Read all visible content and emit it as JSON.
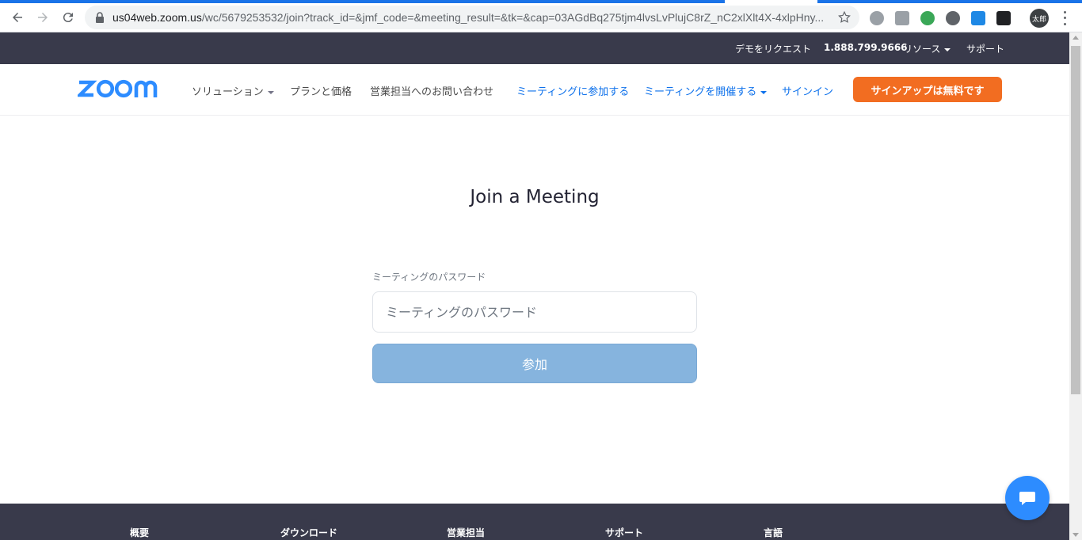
{
  "browser": {
    "url_host": "us04web.zoom.us",
    "url_path": "/wc/5679253532/join?track_id=&jmf_code=&meeting_result=&tk=&cap=03AGdBq275tjm4lvsLvPlujC8rZ_nC2xlXlt4X-4xlpHny...",
    "avatar_text": "太郎"
  },
  "topbar": {
    "demo": "デモをリクエスト",
    "phone": "1.888.799.9666",
    "resources": "リソース",
    "support": "サポート"
  },
  "nav": {
    "solutions": "ソリューション",
    "plans": "プランと価格",
    "sales": "営業担当へのお問い合わせ",
    "join": "ミーティングに参加する",
    "host": "ミーティングを開催する",
    "signin": "サインイン",
    "signup": "サインアップは無料です"
  },
  "main": {
    "title": "Join a Meeting",
    "password_label": "ミーティングのパスワード",
    "password_placeholder": "ミーティングのパスワード",
    "password_value": "",
    "join_button": "参加"
  },
  "footer": {
    "col1": "概要",
    "col2": "ダウンロード",
    "col3": "営業担当",
    "col4": "サポート",
    "col5": "言語"
  },
  "colors": {
    "brand_blue": "#2d8cff",
    "header_dark": "#393a4b",
    "signup_orange": "#f26d21",
    "join_button": "#86b4de"
  },
  "icons": [
    "back-arrow-icon",
    "forward-arrow-icon",
    "reload-icon",
    "lock-icon",
    "star-icon",
    "chat-icon"
  ]
}
